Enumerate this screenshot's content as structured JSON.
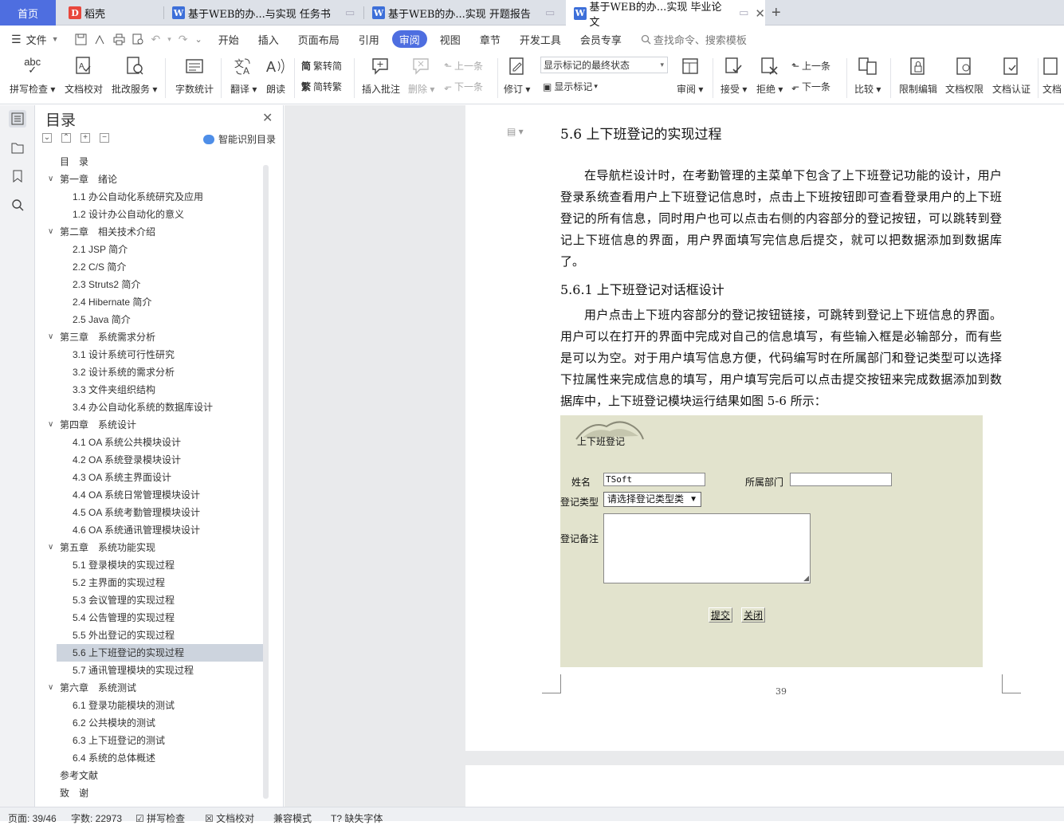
{
  "tabs": {
    "home": "首页",
    "daoke": "稻壳",
    "doc1": "基于WEB的办...与实现 任务书",
    "doc2": "基于WEB的办...实现 开题报告",
    "doc3": "基于WEB的办...实现 毕业论文",
    "add": "+"
  },
  "menu": {
    "file": "文件",
    "items": [
      "开始",
      "插入",
      "页面布局",
      "引用",
      "审阅",
      "视图",
      "章节",
      "开发工具",
      "会员专享"
    ],
    "active_index": 4,
    "search_placeholder": "查找命令、搜索模板"
  },
  "ribbon": {
    "spellcheck": "拼写检查",
    "proofread": "文档校对",
    "annotate_service": "批改服务",
    "wordcount": "字数统计",
    "translate": "翻译",
    "read_aloud": "朗读",
    "trad": "繁转简",
    "simp": "简转繁",
    "insert_comment": "插入批注",
    "delete": "删除",
    "prev_comment": "上一条",
    "next_comment": "下一条",
    "revise": "修订",
    "markup_state": "显示标记的最终状态",
    "show_markup": "显示标记",
    "review": "审阅",
    "accept": "接受",
    "reject": "拒绝",
    "prev": "上一条",
    "next": "下一条",
    "compare": "比较",
    "restrict": "限制编辑",
    "perm": "文档权限",
    "cert": "文档认证",
    "cut": "文档"
  },
  "toc": {
    "title": "目录",
    "smart_btn": "智能识别目录",
    "items": [
      {
        "text": "目　录",
        "level": 0
      },
      {
        "text": "第一章　绪论",
        "level": 1
      },
      {
        "text": "1.1  办公自动化系统研究及应用",
        "level": 2
      },
      {
        "text": "1.2  设计办公自动化的意义",
        "level": 2
      },
      {
        "text": "第二章　相关技术介绍",
        "level": 1
      },
      {
        "text": "2.1 JSP 简介",
        "level": 2
      },
      {
        "text": "2.2 C/S 简介",
        "level": 2
      },
      {
        "text": "2.3 Struts2 简介",
        "level": 2
      },
      {
        "text": "2.4 Hibernate 简介",
        "level": 2
      },
      {
        "text": "2.5 Java 简介",
        "level": 2
      },
      {
        "text": "第三章　系统需求分析",
        "level": 1
      },
      {
        "text": "3.1  设计系统可行性研究",
        "level": 2
      },
      {
        "text": "3.2  设计系统的需求分析",
        "level": 2
      },
      {
        "text": "3.3  文件夹组织结构",
        "level": 2
      },
      {
        "text": "3.4  办公自动化系统的数据库设计",
        "level": 2
      },
      {
        "text": "第四章　系统设计",
        "level": 1
      },
      {
        "text": "4.1 OA 系统公共模块设计",
        "level": 2
      },
      {
        "text": "4.2 OA 系统登录模块设计",
        "level": 2
      },
      {
        "text": "4.3 OA 系统主界面设计",
        "level": 2
      },
      {
        "text": "4.4 OA 系统日常管理模块设计",
        "level": 2
      },
      {
        "text": "4.5 OA 系统考勤管理模块设计",
        "level": 2
      },
      {
        "text": "4.6 OA 系统通讯管理模块设计",
        "level": 2
      },
      {
        "text": "第五章　系统功能实现",
        "level": 1
      },
      {
        "text": "5.1  登录模块的实现过程",
        "level": 2
      },
      {
        "text": "5.2  主界面的实现过程",
        "level": 2
      },
      {
        "text": "5.3  会议管理的实现过程",
        "level": 2
      },
      {
        "text": "5.4  公告管理的实现过程",
        "level": 2
      },
      {
        "text": "5.5  外出登记的实现过程",
        "level": 2
      },
      {
        "text": "5.6  上下班登记的实现过程",
        "level": 2,
        "selected": true
      },
      {
        "text": "5.7  通讯管理模块的实现过程",
        "level": 2
      },
      {
        "text": "第六章　系统测试",
        "level": 1
      },
      {
        "text": "6.1  登录功能模块的测试",
        "level": 2
      },
      {
        "text": "6.2  公共模块的测试",
        "level": 2
      },
      {
        "text": "6.3  上下班登记的测试",
        "level": 2
      },
      {
        "text": "6.4  系统的总体概述",
        "level": 2
      },
      {
        "text": "参考文献",
        "level": 0
      },
      {
        "text": "致　谢",
        "level": 0
      }
    ]
  },
  "document": {
    "heading": "5.6  上下班登记的实现过程",
    "para1": "在导航栏设计时，在考勤管理的主菜单下包含了上下班登记功能的设计，用户登录系统查看用户上下班登记信息时，点击上下班按钮即可查看登录用户的上下班登记的所有信息，同时用户也可以点击右侧的内容部分的登记按钮，可以跳转到登记上下班信息的界面，用户界面填写完信息后提交，就可以把数据添加到数据库了。",
    "subheading": "5.6.1  上下班登记对话框设计",
    "para2": "用户点击上下班内容部分的登记按钮链接，可跳转到登记上下班信息的界面。用户可以在打开的界面中完成对自己的信息填写，有些输入框是必输部分，而有些是可以为空。对于用户填写信息方便，代码编写时在所属部门和登记类型可以选择下拉属性来完成信息的填写，用户填写完后可以点击提交按钮来完成数据添加到数据库中，上下班登记模块运行结果如图 5-6 所示：",
    "page_number": "39"
  },
  "figure": {
    "title": "上下班登记",
    "name_label": "姓名",
    "name_value": "TSoft",
    "dept_label": "所属部门",
    "dept_value": "",
    "type_label": "登记类型",
    "type_value": "请选择登记类型类",
    "note_label": "登记备注",
    "submit": "提交",
    "close": "关闭"
  },
  "status": {
    "page": "页面: 39/46",
    "words": "字数: 22973",
    "spell": "拼写检查",
    "proof": "文档校对",
    "compat": "兼容模式",
    "missing_font": "缺失字体"
  },
  "colors": {
    "accent": "#4e6ee0",
    "figure_bg": "#e2e3cd",
    "toc_selected": "#cdd4de"
  }
}
